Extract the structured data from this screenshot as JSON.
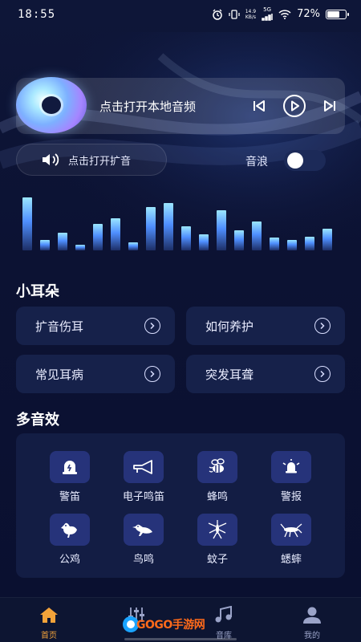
{
  "status_bar": {
    "time": "18:55",
    "net_speed_top": "14.9",
    "net_speed_bottom": "KB/s",
    "network": "5G",
    "battery": "72%",
    "battery_level": 0.72
  },
  "player": {
    "title": "点击打开本地音频"
  },
  "amplify": {
    "label": "点击打开扩音"
  },
  "wave_toggle": {
    "label": "音浪",
    "on": false
  },
  "equalizer": {
    "levels": [
      0.92,
      0.18,
      0.3,
      0.1,
      0.46,
      0.55,
      0.14,
      0.75,
      0.82,
      0.42,
      0.28,
      0.7,
      0.35,
      0.5,
      0.22,
      0.18,
      0.24,
      0.38
    ]
  },
  "ears_section": {
    "title": "小耳朵",
    "cards": [
      {
        "label": "扩音伤耳"
      },
      {
        "label": "如何养护"
      },
      {
        "label": "常见耳病"
      },
      {
        "label": "突发耳聋"
      }
    ]
  },
  "effects_section": {
    "title": "多音效",
    "items": [
      {
        "label": "警笛",
        "icon": "siren-icon"
      },
      {
        "label": "电子鸣笛",
        "icon": "horn-icon"
      },
      {
        "label": "蜂鸣",
        "icon": "bee-icon"
      },
      {
        "label": "警报",
        "icon": "alarm-bell-icon"
      },
      {
        "label": "公鸡",
        "icon": "rooster-icon"
      },
      {
        "label": "鸟鸣",
        "icon": "bird-icon"
      },
      {
        "label": "蚊子",
        "icon": "mosquito-icon"
      },
      {
        "label": "蟋蟀",
        "icon": "cricket-icon"
      }
    ]
  },
  "tabbar": {
    "tabs": [
      {
        "label": "首页",
        "icon": "home-icon",
        "active": true
      },
      {
        "label": "音效",
        "icon": "mixer-icon",
        "active": false
      },
      {
        "label": "音库",
        "icon": "music-note-icon",
        "active": false
      },
      {
        "label": "我的",
        "icon": "user-icon",
        "active": false
      }
    ],
    "watermark": "GOGO手游网"
  },
  "colors": {
    "background": "#0c1233",
    "card": "#16214a",
    "accent_active": "#f2a23a",
    "icon_tile": "#26337a"
  }
}
